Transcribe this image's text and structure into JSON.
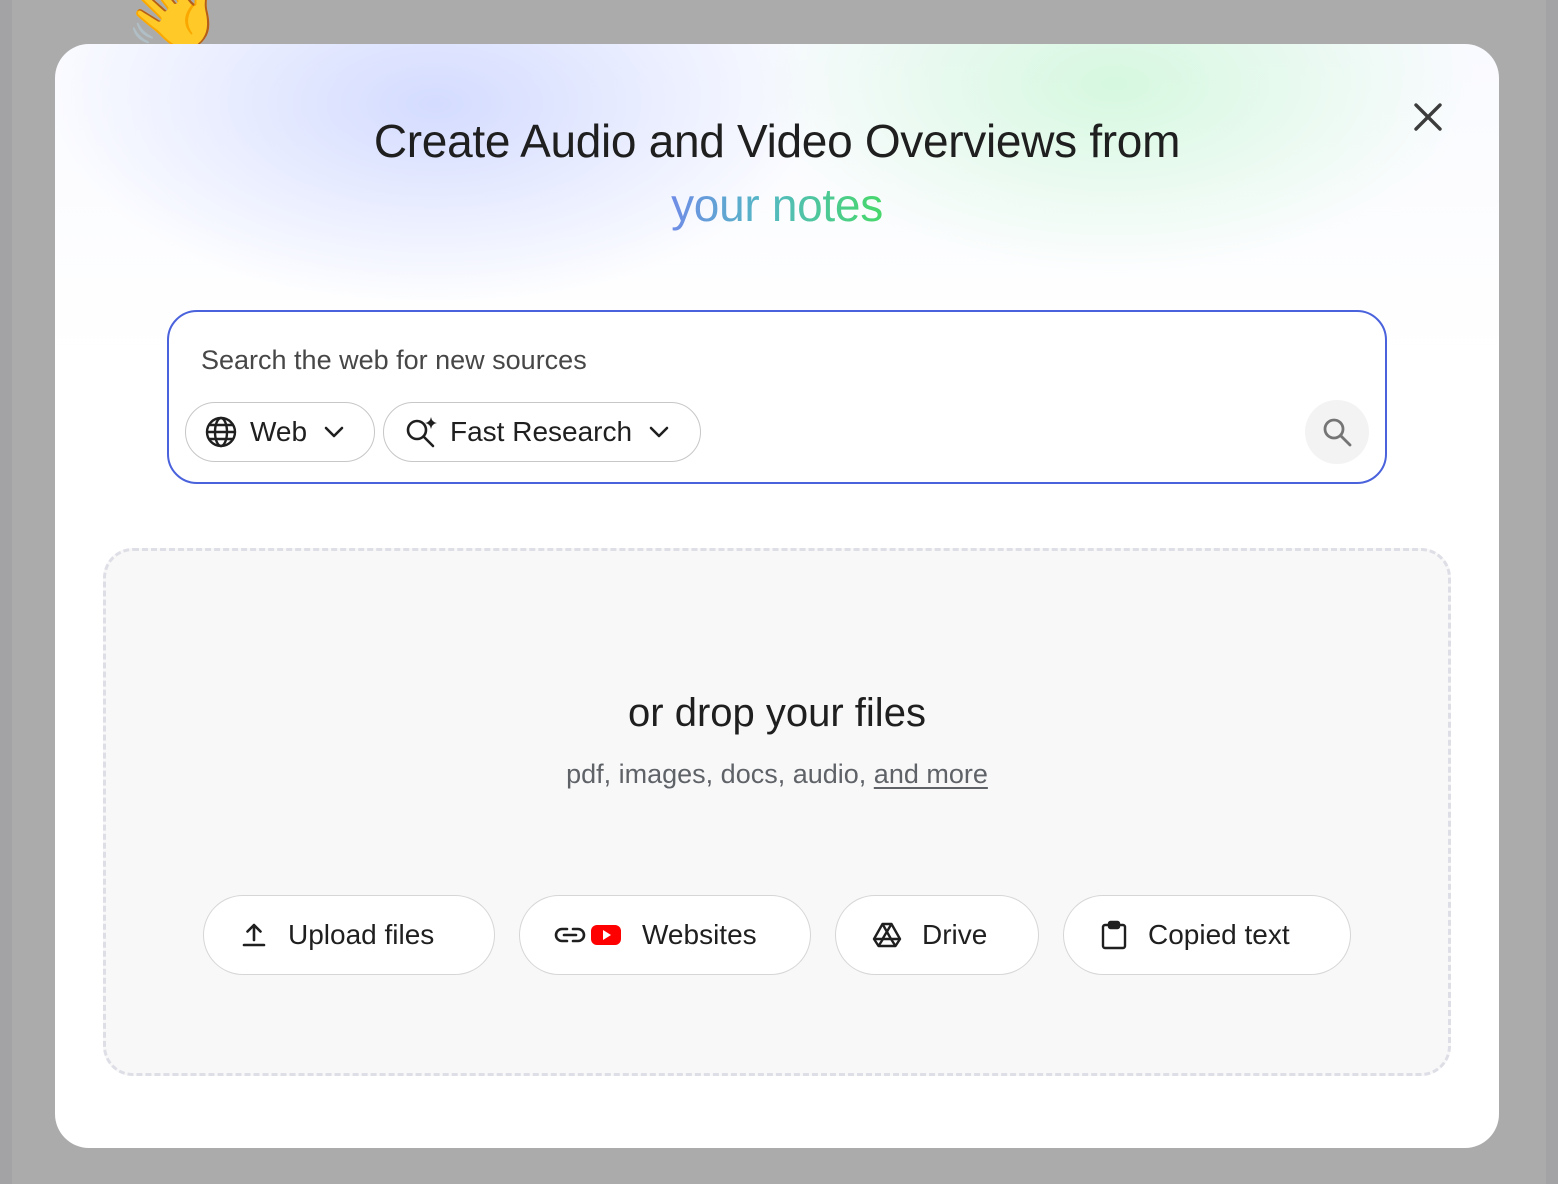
{
  "background": {
    "emoji": "👋"
  },
  "dialog": {
    "title_line1": "Create Audio and Video Overviews from",
    "title_highlight": "your notes",
    "close_icon": "close-icon"
  },
  "search": {
    "placeholder": "Search the web for new sources",
    "value": "",
    "source_chip_label": "Web",
    "mode_chip_label": "Fast Research",
    "submit_icon": "search-icon"
  },
  "dropzone": {
    "title": "or drop your files",
    "subtitle_prefix": "pdf, images, docs, audio, ",
    "subtitle_link": "and more",
    "actions": [
      {
        "label": "Upload files",
        "icon": "upload-icon"
      },
      {
        "label": "Websites",
        "icon": "link-icon"
      },
      {
        "label": "Drive",
        "icon": "drive-icon"
      },
      {
        "label": "Copied text",
        "icon": "clipboard-icon"
      }
    ]
  },
  "colors": {
    "accent_border": "#4a62dc",
    "highlight_start": "#6f8ce6",
    "highlight_end": "#47d86a",
    "youtube_red": "#ff0000"
  }
}
